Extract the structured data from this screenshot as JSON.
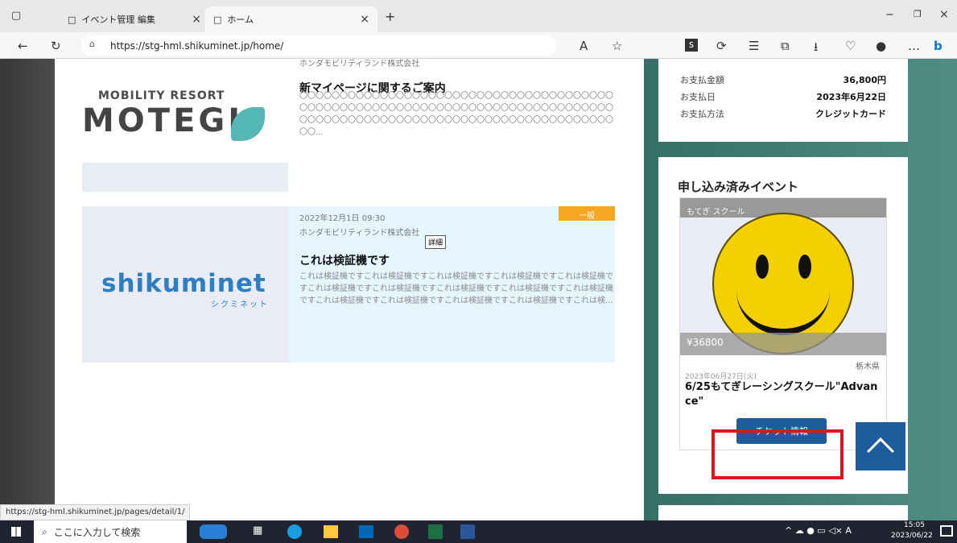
{
  "browser": {
    "tabs": [
      {
        "label": "イベント管理 編集"
      },
      {
        "label": "ホーム"
      }
    ],
    "url": "https://stg-hml.shikuminet.jp/home/",
    "status_url": "https://stg-hml.shikuminet.jp/pages/detail/1/"
  },
  "articles": [
    {
      "company": "ホンダモビリティランド株式会社",
      "title": "新マイページに関するご案内",
      "excerpt": "〇〇〇〇〇〇〇〇〇〇〇〇〇〇〇〇〇〇〇〇〇〇〇〇〇〇〇〇〇〇〇〇〇〇〇〇〇〇〇〇〇〇〇〇〇〇〇〇〇〇〇〇〇〇〇〇〇〇〇〇〇〇〇〇〇〇〇〇〇〇〇〇〇〇〇〇〇〇〇〇〇〇〇〇〇〇〇〇〇〇〇〇〇〇〇〇〇〇〇〇〇〇〇〇〇〇〇〇〇〇〇〇〇〇〇〇〇〇〇...",
      "logo_line1": "MOBILITY RESORT",
      "logo_line2": "MOTEGI"
    },
    {
      "date": "2022年12月1日 09:30",
      "badge": "一般",
      "company": "ホンダモビリティランド株式会社",
      "tooltip": "詳細",
      "title": "これは検証機です",
      "excerpt": "これは検証機ですこれは検証機ですこれは検証機ですこれは検証機ですこれは検証機ですこれは検証機ですこれは検証機ですこれは検証機ですこれは検証機ですこれは検証機ですこれは検証機ですこれは検証機ですこれは検証機ですこれは検証機ですこれは検...",
      "logo_text": "shikuminet",
      "logo_sub": "シクミネット"
    }
  ],
  "payment": {
    "amount_label": "お支払金額",
    "amount_value": "36,800円",
    "date_label": "お支払日",
    "date_value": "2023年6月22日",
    "method_label": "お支払方法",
    "method_value": "クレジットカード"
  },
  "events": {
    "section_title": "申し込み済みイベント",
    "card": {
      "tag": "もてぎ スクール",
      "price": "¥36800",
      "location": "栃木県",
      "date": "2023年06月27日(火)",
      "title": "6/25もてぎレーシングスクール\"Advance\"",
      "button": "チケット情報"
    }
  },
  "taskbar": {
    "search_placeholder": "ここに入力して検索",
    "time": "15:05",
    "date": "2023/06/22"
  },
  "colors": {
    "accent_blue": "#1f5c9c",
    "badge_orange": "#f5a623",
    "highlight_red": "#e0141c"
  }
}
